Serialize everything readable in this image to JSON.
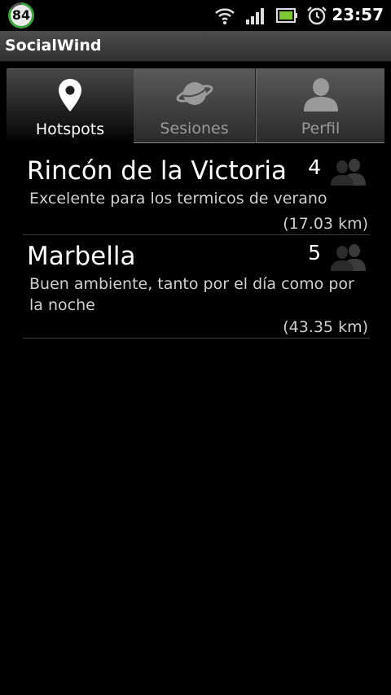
{
  "status_bar": {
    "battery_level": "84",
    "time": "23:57",
    "icons": [
      "wifi-icon",
      "signal-icon",
      "battery-icon",
      "alarm-icon"
    ]
  },
  "app": {
    "title": "SocialWind"
  },
  "tabs": [
    {
      "label": "Hotspots",
      "icon": "map-pin-icon",
      "selected": true
    },
    {
      "label": "Sesiones",
      "icon": "planet-icon",
      "selected": false
    },
    {
      "label": "Perfil",
      "icon": "person-icon",
      "selected": false
    }
  ],
  "spots": [
    {
      "name": "Rincón de la Victoria",
      "count": "4",
      "description": "Excelente para los termicos de verano",
      "distance": "(17.03 km)"
    },
    {
      "name": "Marbella",
      "count": "5",
      "description": "Buen ambiente, tanto por el día como por la noche",
      "distance": "(43.35 km)"
    }
  ],
  "colors": {
    "background": "#000000",
    "title_bar": "#404040",
    "battery_ring": "#3aa53a",
    "inactive_tab_text": "#9a9a9a",
    "secondary_text": "#d0d0d0"
  }
}
